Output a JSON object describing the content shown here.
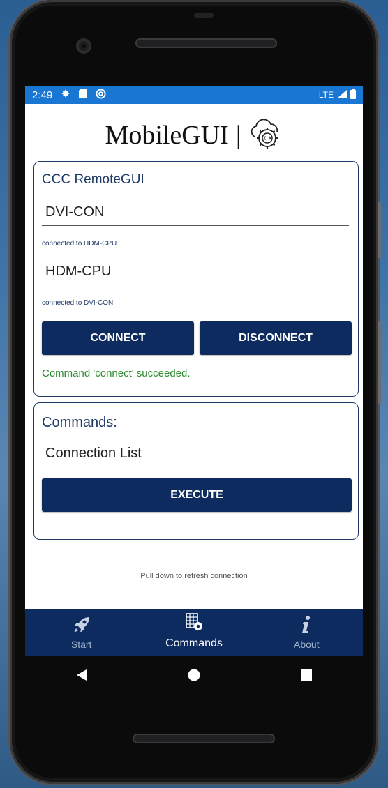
{
  "status_bar": {
    "time": "2:49",
    "left_icons": [
      "gear-icon",
      "sd-card-icon",
      "at-sign-icon"
    ],
    "network": "LTE",
    "right_icons": [
      "signal-icon",
      "battery-icon"
    ]
  },
  "header": {
    "logo_text": "MobileGUI",
    "separator": "|",
    "logo_icon": "cloud-gear-code-icon"
  },
  "remote_card": {
    "title": "CCC RemoteGUI",
    "field1": {
      "value": "DVI-CON",
      "hint": "connected to HDM-CPU"
    },
    "field2": {
      "value": "HDM-CPU",
      "hint": "connected to DVI-CON"
    },
    "connect_label": "CONNECT",
    "disconnect_label": "DISCONNECT",
    "status_message": "Command 'connect' succeeded.",
    "status_color": "#2e8b2e"
  },
  "commands_card": {
    "title": "Commands:",
    "selected_command": "Connection List",
    "execute_label": "EXECUTE"
  },
  "pull_hint": "Pull down to refresh connection",
  "tabs": [
    {
      "label": "Start",
      "icon": "rocket-icon",
      "active": false
    },
    {
      "label": "Commands",
      "icon": "table-gear-icon",
      "active": true
    },
    {
      "label": "About",
      "icon": "info-icon",
      "active": false
    }
  ],
  "nav_buttons": [
    "back-icon",
    "home-icon",
    "recents-icon"
  ],
  "colors": {
    "primary": "#0d2b5e",
    "status_bar": "#1976d2",
    "border": "#1f3a66"
  }
}
